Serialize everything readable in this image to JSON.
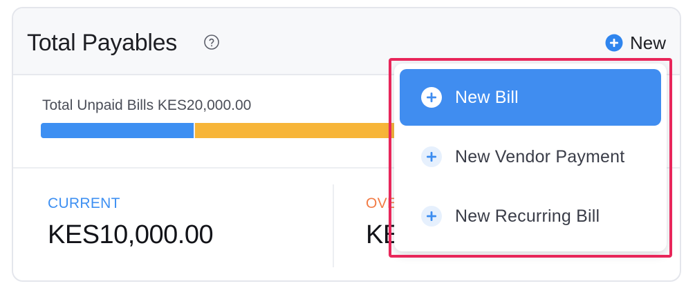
{
  "header": {
    "title": "Total Payables",
    "help_icon": "question-circle-icon",
    "new_button_label": "New"
  },
  "unpaid": {
    "label": "Total Unpaid Bills KES20,000.00",
    "current_fraction": 0.5,
    "overdue_fraction": 0.5,
    "colors": {
      "current": "#3d8ff2",
      "overdue": "#f7b538"
    }
  },
  "stats": {
    "current": {
      "label": "CURRENT",
      "value": "KES10,000.00",
      "color": "#3d8ff2"
    },
    "overdue": {
      "label_visible": "OVE",
      "value_visible": "KE",
      "color": "#f27b45"
    }
  },
  "dropdown": {
    "items": [
      {
        "label": "New Bill",
        "icon": "plus-circle-icon",
        "active": true
      },
      {
        "label": "New Vendor Payment",
        "icon": "plus-circle-icon",
        "active": false
      },
      {
        "label": "New Recurring Bill",
        "icon": "plus-circle-icon",
        "active": false
      }
    ],
    "highlight_color": "#e8265a"
  }
}
